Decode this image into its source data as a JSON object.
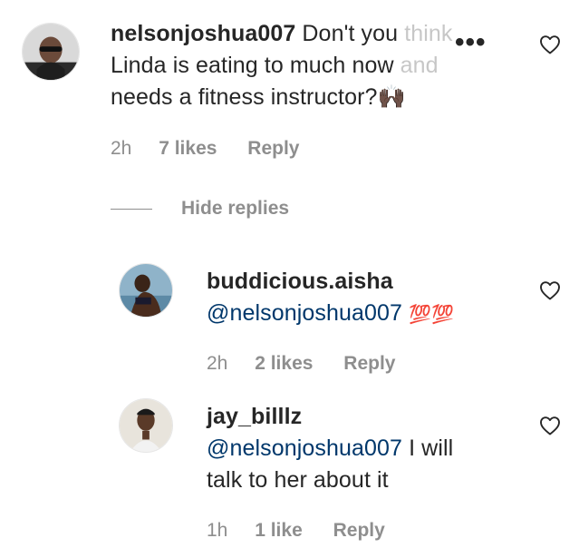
{
  "comments": [
    {
      "username": "nelsonjoshua007",
      "text_line1": "Don't you",
      "text_line1_faded": "think",
      "text_line2": "Linda is eating to much now",
      "text_line2_faded": "and",
      "text_line3": "needs a fitness instructor?",
      "emoji": "🙌🏿",
      "time": "2h",
      "likes": "7 likes",
      "reply_label": "Reply",
      "options_glyph": "•••"
    }
  ],
  "hide_replies_label": "Hide replies",
  "replies": [
    {
      "username": "buddicious.aisha",
      "mention": "@nelsonjoshua007",
      "emoji": "💯💯",
      "time": "2h",
      "likes": "2 likes",
      "reply_label": "Reply"
    },
    {
      "username": "jay_billlz",
      "mention": "@nelsonjoshua007",
      "text_line1": "I will",
      "text_line2": "talk to her about it",
      "time": "1h",
      "likes": "1 like",
      "reply_label": "Reply"
    }
  ],
  "icons": {
    "heart": "heart-outline-icon",
    "options": "more-options-icon"
  },
  "colors": {
    "text": "#262626",
    "meta": "#8e8e8e",
    "mention": "#00376b",
    "background": "#ffffff"
  }
}
